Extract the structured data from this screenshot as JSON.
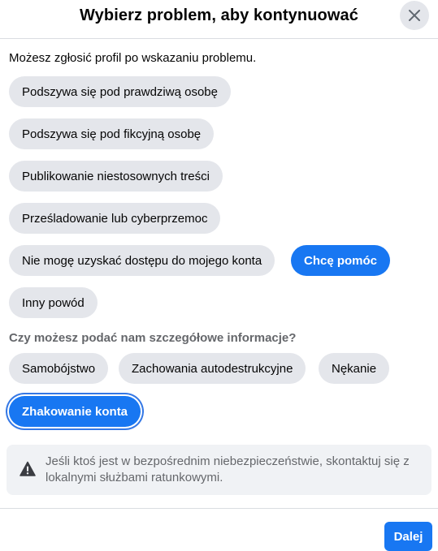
{
  "dialog": {
    "title": "Wybierz problem, aby kontynuować",
    "close_icon": "close-icon"
  },
  "intro_text": "Możesz zgłosić profil po wskazaniu problemu.",
  "problems": [
    {
      "label": "Podszywa się pod prawdziwą osobę",
      "selected": false
    },
    {
      "label": "Podszywa się pod fikcyjną osobę",
      "selected": false
    },
    {
      "label": "Publikowanie niestosownych treści",
      "selected": false
    },
    {
      "label": "Prześladowanie lub cyberprzemoc",
      "selected": false
    },
    {
      "label": "Nie mogę uzyskać dostępu do mojego konta",
      "selected": false
    },
    {
      "label": "Chcę pomóc",
      "selected": true
    },
    {
      "label": "Inny powód",
      "selected": false
    }
  ],
  "details_prompt": "Czy możesz podać nam szczegółowe informacje?",
  "details": [
    {
      "label": "Samobójstwo",
      "selected": false
    },
    {
      "label": "Zachowania autodestrukcyjne",
      "selected": false
    },
    {
      "label": "Nękanie",
      "selected": false
    },
    {
      "label": "Zhakowanie konta",
      "selected": true
    }
  ],
  "notice": {
    "icon": "warning-icon",
    "text": "Jeśli ktoś jest w bezpośrednim niebezpieczeństwie, skontaktuj się z lokalnymi służbami ratunkowymi."
  },
  "footer": {
    "next_label": "Dalej"
  },
  "colors": {
    "accent": "#1877f2",
    "pill_bg": "#e4e6eb",
    "notice_bg": "#f0f2f5",
    "secondary_text": "#65676b"
  }
}
